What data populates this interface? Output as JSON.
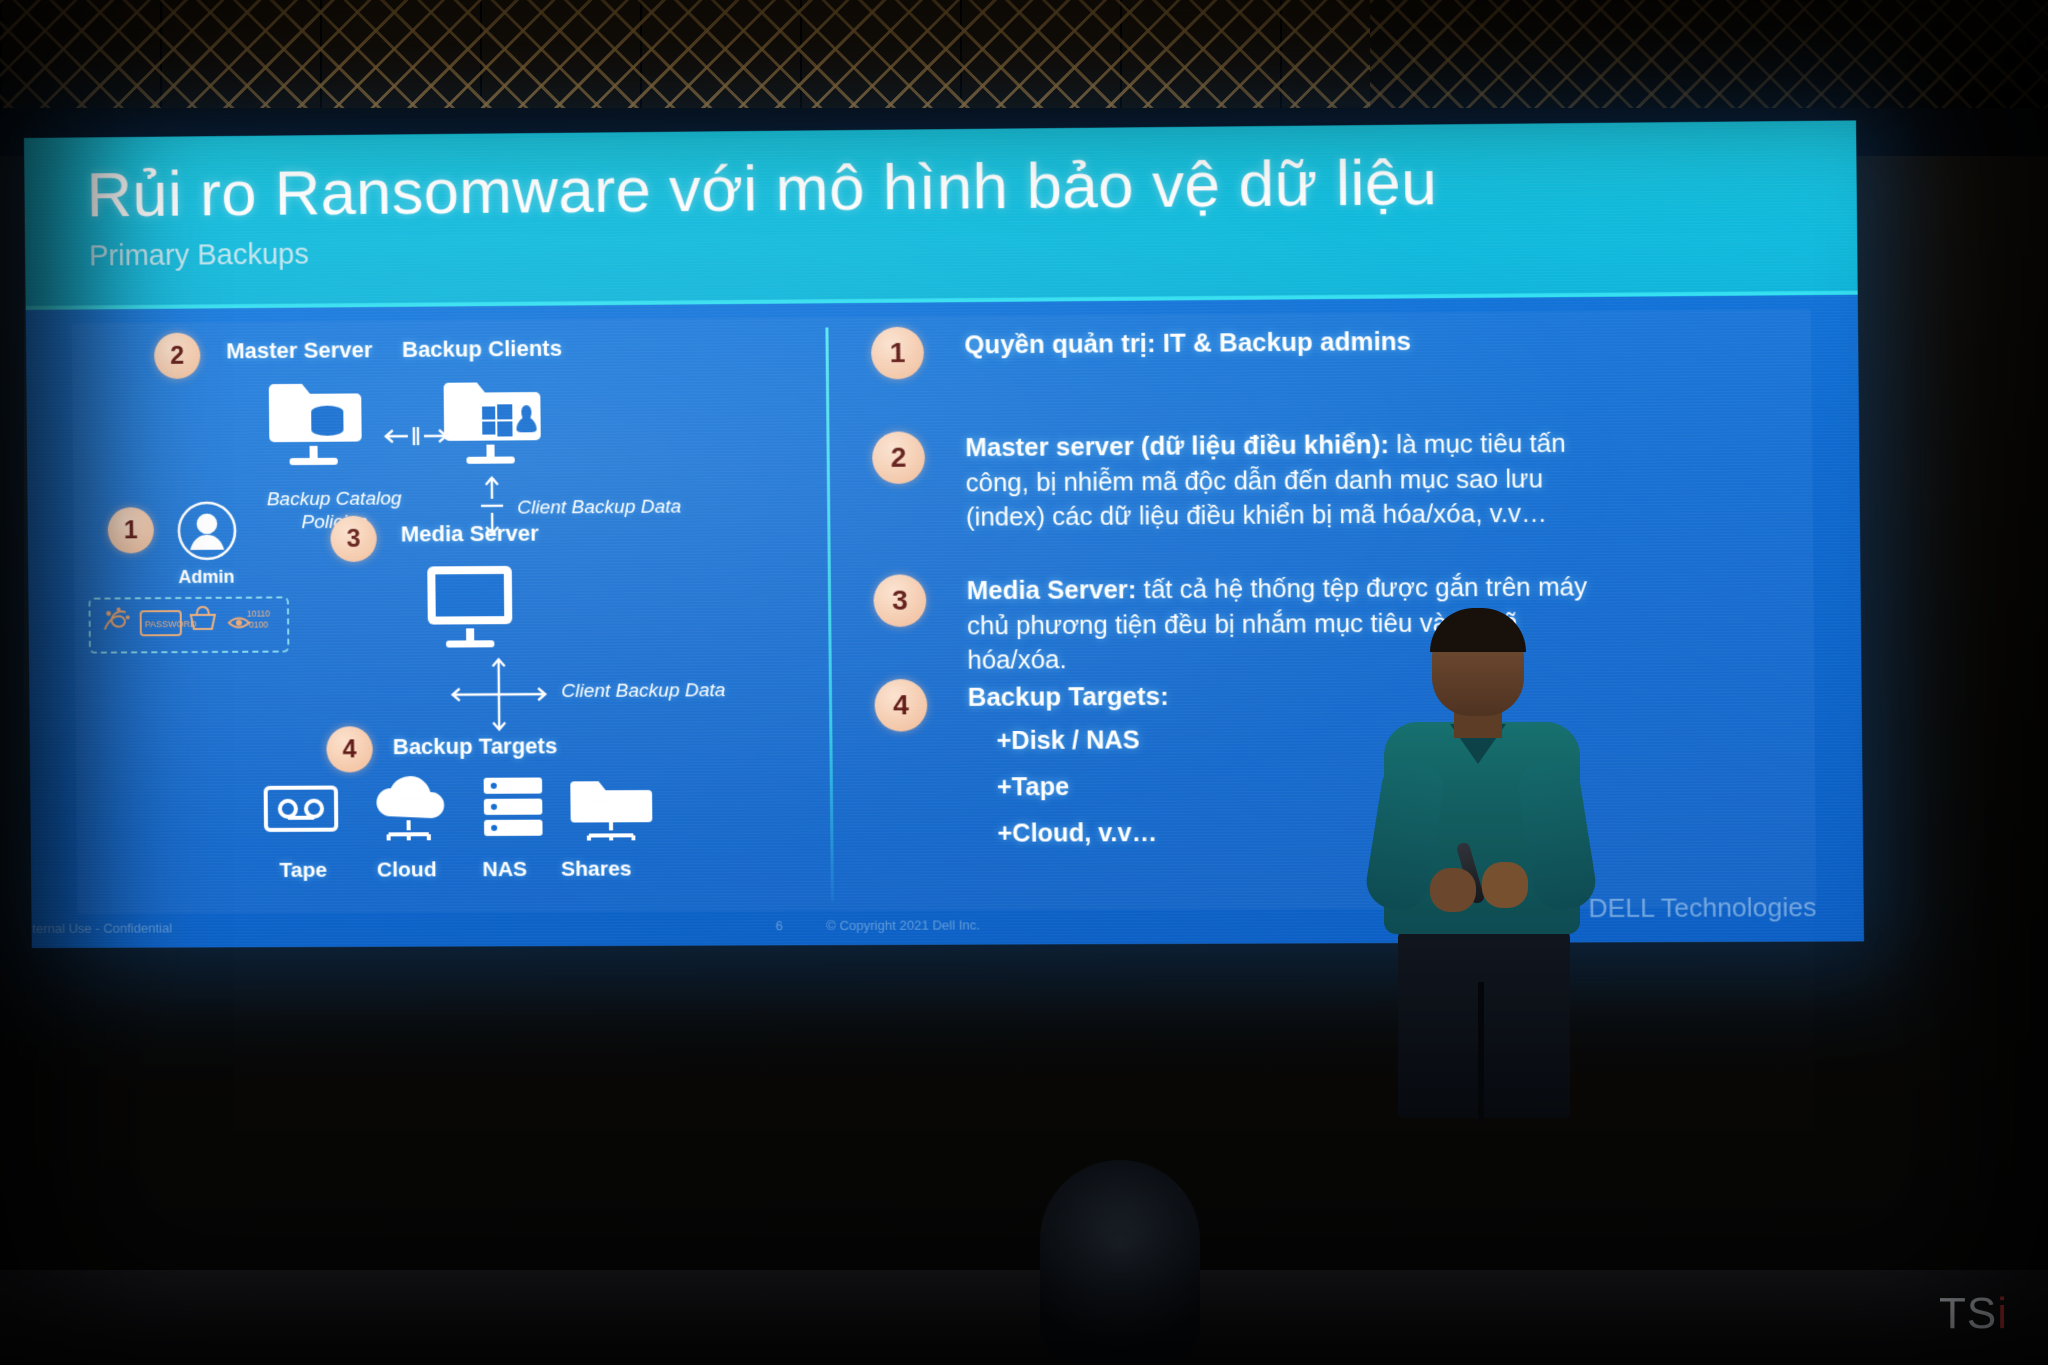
{
  "slide": {
    "title": "Rủi ro Ransomware với mô hình bảo vệ dữ liệu",
    "subtitle": "Primary Backups",
    "footer_left": "Internal Use - Confidential",
    "footer_page": "6",
    "footer_copyright": "© Copyright 2021 Dell Inc.",
    "brand": "DELL Technologies"
  },
  "diagram": {
    "nodes": [
      {
        "badge": "2",
        "label": "Master Server",
        "caption": "Backup Catalog\nPolicies"
      },
      {
        "badge": "",
        "label": "Backup Clients",
        "caption": "Client Backup Data"
      },
      {
        "badge": "1",
        "label": "Admin",
        "caption": ""
      },
      {
        "badge": "3",
        "label": "Media Server",
        "caption": "Client Backup Data"
      },
      {
        "badge": "4",
        "label": "Backup Targets",
        "caption": ""
      }
    ],
    "master_server_label": "Master Server",
    "backup_clients_label": "Backup Clients",
    "backup_catalog_line1": "Backup Catalog",
    "backup_catalog_line2": "Policies",
    "client_backup_data_1": "Client Backup Data",
    "client_backup_data_2": "Client Backup Data",
    "admin_label": "Admin",
    "media_server_label": "Media Server",
    "backup_targets_label": "Backup Targets",
    "targets": [
      {
        "icon": "tape-icon",
        "label": "Tape"
      },
      {
        "icon": "cloud-icon",
        "label": "Cloud"
      },
      {
        "icon": "nas-icon",
        "label": "NAS"
      },
      {
        "icon": "shares-icon",
        "label": "Shares"
      }
    ],
    "badges": {
      "one": "1",
      "two": "2",
      "three": "3",
      "four": "4"
    }
  },
  "risk_list": [
    {
      "num": "1",
      "bold": "Quyền quản trị:",
      "rest": " IT & Backup admins"
    },
    {
      "num": "2",
      "bold": "Master server (dữ liệu điều khiển):",
      "rest": " là mục tiêu tấn công, bị nhiễm mã độc dẫn đến danh mục sao lưu (index) các dữ liệu điều khiển bị mã hóa/xóa, v.v…"
    },
    {
      "num": "3",
      "bold": "Media Server:",
      "rest": " tất cả hệ thống tệp được gắn trên máy chủ phương tiện đều bị nhắm mục tiêu và bị mã hóa/xóa."
    },
    {
      "num": "4",
      "bold": "Backup Targets:",
      "rest": "",
      "bullets": [
        "+Disk / NAS",
        "+Tape",
        "+Cloud, v.v…"
      ]
    }
  ],
  "watermark": {
    "text": "TS",
    "accent": "i"
  },
  "colors": {
    "header_cyan": "#13bedd",
    "body_blue": "#0f6ad0",
    "badge_peach": "#f2bb96",
    "badge_text": "#5c1410",
    "divider_cyan": "#3fd4ec",
    "watermark_red": "#e8433c"
  }
}
